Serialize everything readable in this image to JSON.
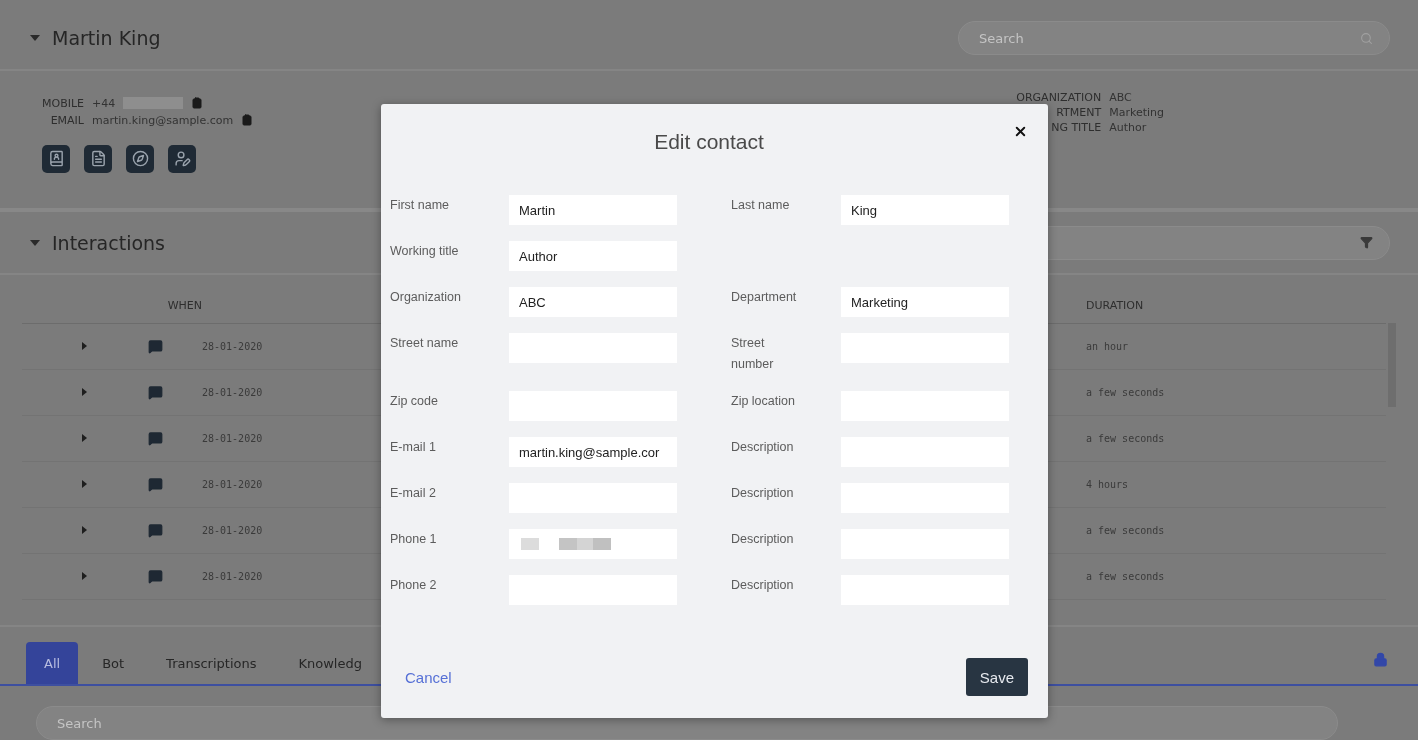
{
  "contact_header": {
    "name": "Martin King",
    "expanded": true,
    "search": {
      "placeholder": "Search"
    }
  },
  "details": {
    "left": [
      {
        "label": "MOBILE",
        "value": "+44",
        "redacted": true
      },
      {
        "label": "EMAIL",
        "value": "martin.king@sample.com",
        "redacted": false
      }
    ],
    "right": [
      {
        "label": "ORGANIZATION",
        "value": "ABC"
      },
      {
        "label": "RTMENT",
        "value": "Marketing"
      },
      {
        "label": "NG TITLE",
        "value": "Author"
      }
    ]
  },
  "interactions_header": {
    "title": "Interactions",
    "expanded": true
  },
  "table": {
    "columns": [
      "WHEN",
      "DURATION"
    ],
    "rows": [
      {
        "when": "28-01-2020",
        "duration": "an hour"
      },
      {
        "when": "28-01-2020",
        "duration": "a few seconds"
      },
      {
        "when": "28-01-2020",
        "duration": "a few seconds"
      },
      {
        "when": "28-01-2020",
        "duration": "4 hours"
      },
      {
        "when": "28-01-2020",
        "duration": "a few seconds"
      },
      {
        "when": "28-01-2020",
        "duration": "a few seconds"
      }
    ]
  },
  "tabs": [
    {
      "label": "All",
      "selected": true
    },
    {
      "label": "Bot",
      "selected": false
    },
    {
      "label": "Transcriptions",
      "selected": false
    },
    {
      "label": "Knowledg",
      "selected": false
    }
  ],
  "bottom_search": {
    "placeholder": "Search"
  },
  "dialog": {
    "title": "Edit contact",
    "rows": [
      {
        "left": {
          "label": "First name",
          "value": "Martin",
          "kind": "text"
        },
        "right": {
          "label": "Last name",
          "value": "King",
          "kind": "text"
        }
      },
      {
        "left": {
          "label": "Working title",
          "value": "Author",
          "kind": "text"
        }
      },
      {
        "left": {
          "label": "Organization",
          "value": "ABC",
          "kind": "text"
        },
        "right": {
          "label": "Department",
          "value": "Marketing",
          "kind": "text"
        }
      },
      {
        "left": {
          "label": "Street name",
          "kind": "text"
        },
        "right": {
          "label": "Street number",
          "kind": "text"
        }
      },
      {
        "left": {
          "label": "Zip code",
          "kind": "text"
        },
        "right": {
          "label": "Zip location",
          "kind": "text"
        }
      },
      {
        "left": {
          "label": "E-mail 1",
          "value": "martin.king@sample.cor",
          "kind": "text"
        },
        "right": {
          "label": "Description",
          "kind": "text"
        }
      },
      {
        "left": {
          "label": "E-mail 2",
          "kind": "text"
        },
        "right": {
          "label": "Description",
          "kind": "text"
        }
      },
      {
        "left": {
          "label": "Phone 1",
          "kind": "redacted"
        },
        "right": {
          "label": "Description",
          "kind": "text"
        }
      },
      {
        "left": {
          "label": "Phone 2",
          "kind": "text"
        },
        "right": {
          "label": "Description",
          "kind": "text"
        }
      }
    ],
    "cancel": "Cancel",
    "save": "Save"
  }
}
